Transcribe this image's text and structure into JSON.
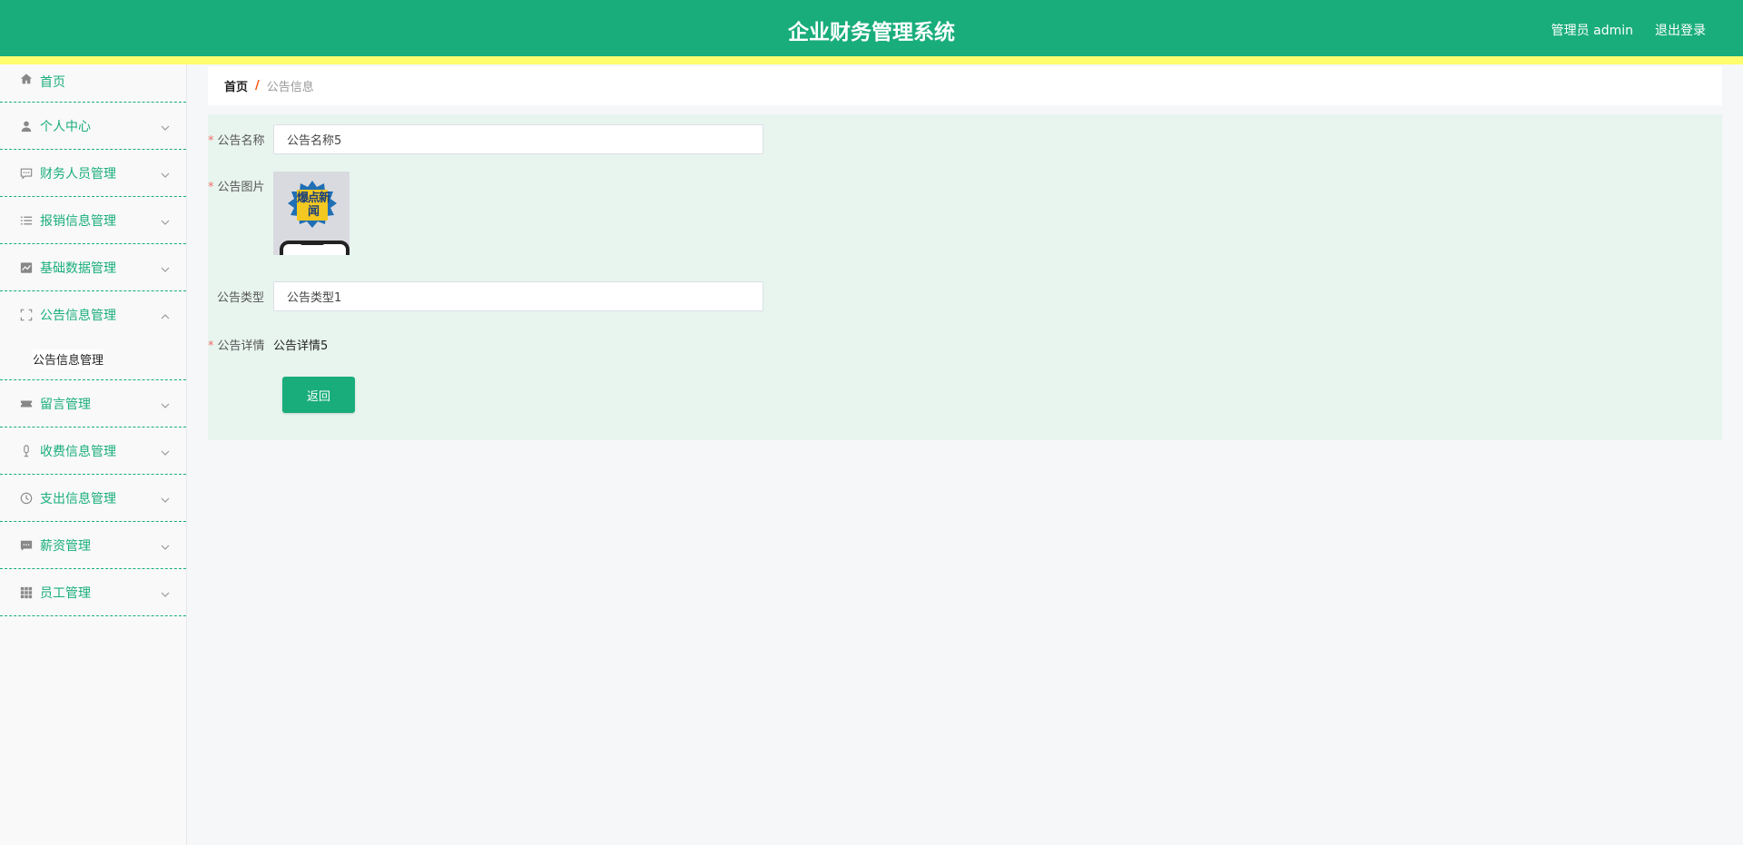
{
  "header": {
    "title": "企业财务管理系统",
    "user": "管理员 admin",
    "logout": "退出登录"
  },
  "sidebar": {
    "items": [
      {
        "label": "首页",
        "icon": "home-icon"
      },
      {
        "label": "个人中心",
        "icon": "user-icon"
      },
      {
        "label": "财务人员管理",
        "icon": "message-icon"
      },
      {
        "label": "报销信息管理",
        "icon": "list-icon"
      },
      {
        "label": "基础数据管理",
        "icon": "chart-icon"
      },
      {
        "label": "公告信息管理",
        "icon": "fullscreen-icon",
        "submenu": "公告信息管理"
      },
      {
        "label": "留言管理",
        "icon": "ticket-icon"
      },
      {
        "label": "收费信息管理",
        "icon": "microphone-icon"
      },
      {
        "label": "支出信息管理",
        "icon": "clock-icon"
      },
      {
        "label": "薪资管理",
        "icon": "chat-icon"
      },
      {
        "label": "员工管理",
        "icon": "grid-icon"
      }
    ]
  },
  "breadcrumb": {
    "home": "首页",
    "separator": "/",
    "current": "公告信息"
  },
  "form": {
    "name_label": "公告名称",
    "name_value": "公告名称5",
    "image_label": "公告图片",
    "image_text": "爆点新闻",
    "type_label": "公告类型",
    "type_value": "公告类型1",
    "detail_label": "公告详情",
    "detail_value": "公告详情5",
    "back_button": "返回"
  },
  "colors": {
    "primary": "#19ad7c",
    "header_strip": "#fffd6e",
    "panel": "#e8f5ef",
    "required": "#f56c6c",
    "breadcrumb_separator": "#ff4b00"
  }
}
